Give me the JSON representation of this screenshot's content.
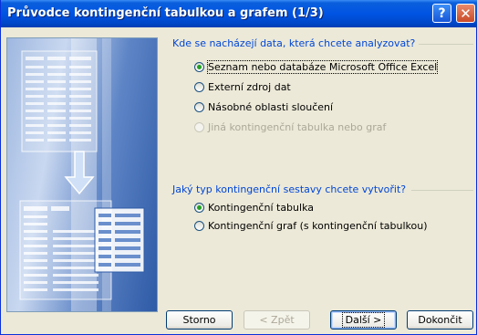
{
  "window": {
    "title": "Průvodce kontingenční tabulkou a grafem (1/3)"
  },
  "title_buttons": {
    "help": "?",
    "close": "✕"
  },
  "source_group": {
    "label": "Kde se nacházejí data, která chcete analyzovat?",
    "options": [
      {
        "label": "Seznam nebo databáze Microsoft Office Excel",
        "selected": true,
        "disabled": false
      },
      {
        "label": "Externí zdroj dat",
        "selected": false,
        "disabled": false
      },
      {
        "label": "Násobné oblasti sloučení",
        "selected": false,
        "disabled": false
      },
      {
        "label": "Jiná kontingenční tabulka nebo graf",
        "selected": false,
        "disabled": true
      }
    ]
  },
  "report_group": {
    "label": "Jaký typ kontingenční sestavy chcete vytvořit?",
    "options": [
      {
        "label": "Kontingenční tabulka",
        "selected": true,
        "disabled": false
      },
      {
        "label": "Kontingenční graf (s kontingenční tabulkou)",
        "selected": false,
        "disabled": false
      }
    ]
  },
  "buttons": {
    "cancel": "Storno",
    "back": "< Zpět",
    "next": "Další >",
    "finish": "Dokončit"
  },
  "icons": {
    "illustration": "wizard-table-illustration",
    "arrow": "down-arrow-icon"
  },
  "colors": {
    "title_bar": "#0054e3",
    "group_label": "#0046d5",
    "dialog_bg": "#ece9d8"
  }
}
